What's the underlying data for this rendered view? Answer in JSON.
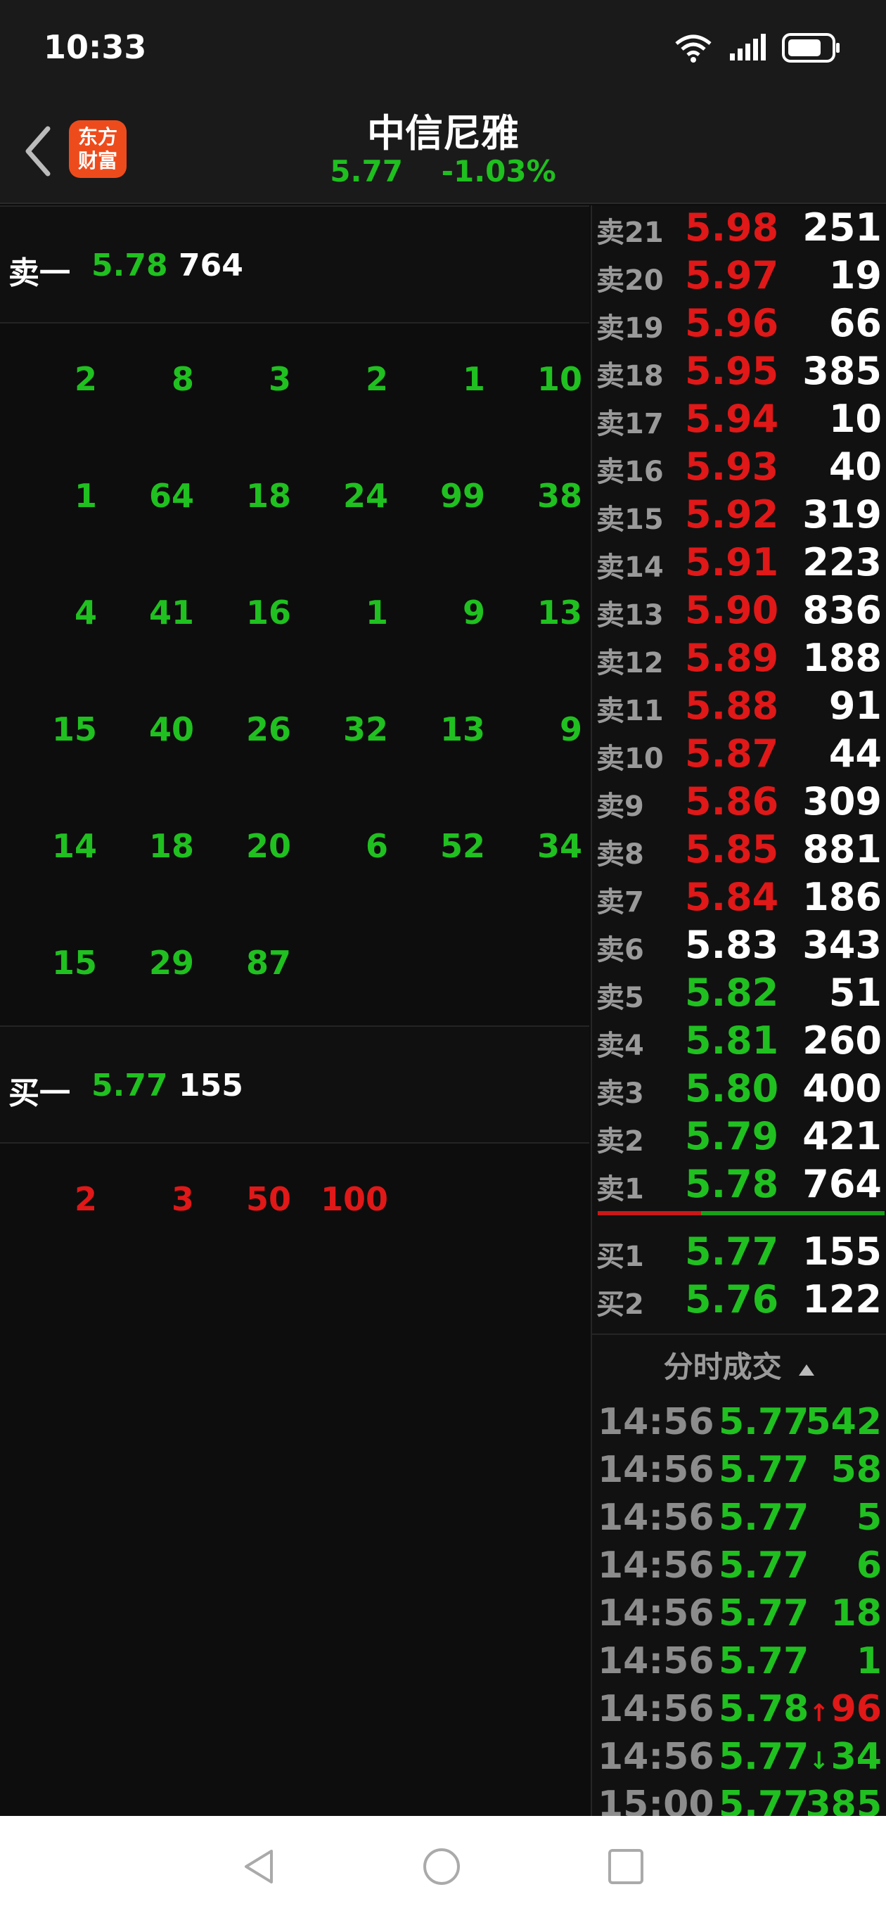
{
  "status": {
    "time": "10:33"
  },
  "header": {
    "title": "中信尼雅",
    "price": "5.77",
    "change": "-1.03%",
    "logo_line1": "东方",
    "logo_line2": "财富"
  },
  "left": {
    "sell1": {
      "label": "卖一",
      "price": "5.78",
      "vol": "764"
    },
    "sell_queue": [
      [
        "2",
        "8",
        "3",
        "2",
        "1",
        "10"
      ],
      [
        "1",
        "64",
        "18",
        "24",
        "99",
        "38"
      ],
      [
        "4",
        "41",
        "16",
        "1",
        "9",
        "13"
      ],
      [
        "15",
        "40",
        "26",
        "32",
        "13",
        "9"
      ],
      [
        "14",
        "18",
        "20",
        "6",
        "52",
        "34"
      ],
      [
        "15",
        "29",
        "87"
      ]
    ],
    "buy1": {
      "label": "买一",
      "price": "5.77",
      "vol": "155"
    },
    "buy_queue": [
      [
        "2",
        "3",
        "50",
        "100"
      ]
    ]
  },
  "orderbook": [
    {
      "label": "卖21",
      "price": "5.98",
      "vol": "251",
      "color": "red"
    },
    {
      "label": "卖20",
      "price": "5.97",
      "vol": "19",
      "color": "red"
    },
    {
      "label": "卖19",
      "price": "5.96",
      "vol": "66",
      "color": "red"
    },
    {
      "label": "卖18",
      "price": "5.95",
      "vol": "385",
      "color": "red"
    },
    {
      "label": "卖17",
      "price": "5.94",
      "vol": "10",
      "color": "red"
    },
    {
      "label": "卖16",
      "price": "5.93",
      "vol": "40",
      "color": "red"
    },
    {
      "label": "卖15",
      "price": "5.92",
      "vol": "319",
      "color": "red"
    },
    {
      "label": "卖14",
      "price": "5.91",
      "vol": "223",
      "color": "red"
    },
    {
      "label": "卖13",
      "price": "5.90",
      "vol": "836",
      "color": "red"
    },
    {
      "label": "卖12",
      "price": "5.89",
      "vol": "188",
      "color": "red"
    },
    {
      "label": "卖11",
      "price": "5.88",
      "vol": "91",
      "color": "red"
    },
    {
      "label": "卖10",
      "price": "5.87",
      "vol": "44",
      "color": "red"
    },
    {
      "label": "卖9",
      "price": "5.86",
      "vol": "309",
      "color": "red"
    },
    {
      "label": "卖8",
      "price": "5.85",
      "vol": "881",
      "color": "red"
    },
    {
      "label": "卖7",
      "price": "5.84",
      "vol": "186",
      "color": "red"
    },
    {
      "label": "卖6",
      "price": "5.83",
      "vol": "343",
      "color": "white"
    },
    {
      "label": "卖5",
      "price": "5.82",
      "vol": "51",
      "color": "green"
    },
    {
      "label": "卖4",
      "price": "5.81",
      "vol": "260",
      "color": "green"
    },
    {
      "label": "卖3",
      "price": "5.80",
      "vol": "400",
      "color": "green"
    },
    {
      "label": "卖2",
      "price": "5.79",
      "vol": "421",
      "color": "green"
    },
    {
      "label": "卖1",
      "price": "5.78",
      "vol": "764",
      "color": "green"
    }
  ],
  "buybook": [
    {
      "label": "买1",
      "price": "5.77",
      "vol": "155",
      "color": "green"
    },
    {
      "label": "买2",
      "price": "5.76",
      "vol": "122",
      "color": "green"
    }
  ],
  "ticks_title": "分时成交",
  "ticks": [
    {
      "time": "14:56",
      "price": "5.77",
      "vol": "542",
      "pcolor": "green",
      "vcolor": "green",
      "arrow": ""
    },
    {
      "time": "14:56",
      "price": "5.77",
      "vol": "58",
      "pcolor": "green",
      "vcolor": "green",
      "arrow": ""
    },
    {
      "time": "14:56",
      "price": "5.77",
      "vol": "5",
      "pcolor": "green",
      "vcolor": "green",
      "arrow": ""
    },
    {
      "time": "14:56",
      "price": "5.77",
      "vol": "6",
      "pcolor": "green",
      "vcolor": "green",
      "arrow": ""
    },
    {
      "time": "14:56",
      "price": "5.77",
      "vol": "18",
      "pcolor": "green",
      "vcolor": "green",
      "arrow": ""
    },
    {
      "time": "14:56",
      "price": "5.77",
      "vol": "1",
      "pcolor": "green",
      "vcolor": "green",
      "arrow": ""
    },
    {
      "time": "14:56",
      "price": "5.78",
      "vol": "96",
      "pcolor": "green",
      "vcolor": "red",
      "arrow": "↑"
    },
    {
      "time": "14:56",
      "price": "5.77",
      "vol": "34",
      "pcolor": "green",
      "vcolor": "green",
      "arrow": "↓"
    },
    {
      "time": "15:00",
      "price": "5.77",
      "vol": "385",
      "pcolor": "green",
      "vcolor": "green",
      "arrow": ""
    }
  ],
  "colors": {
    "green": "#20c020",
    "red": "#e01818",
    "white": "#ffffff",
    "brand": "#ee4b1c"
  }
}
